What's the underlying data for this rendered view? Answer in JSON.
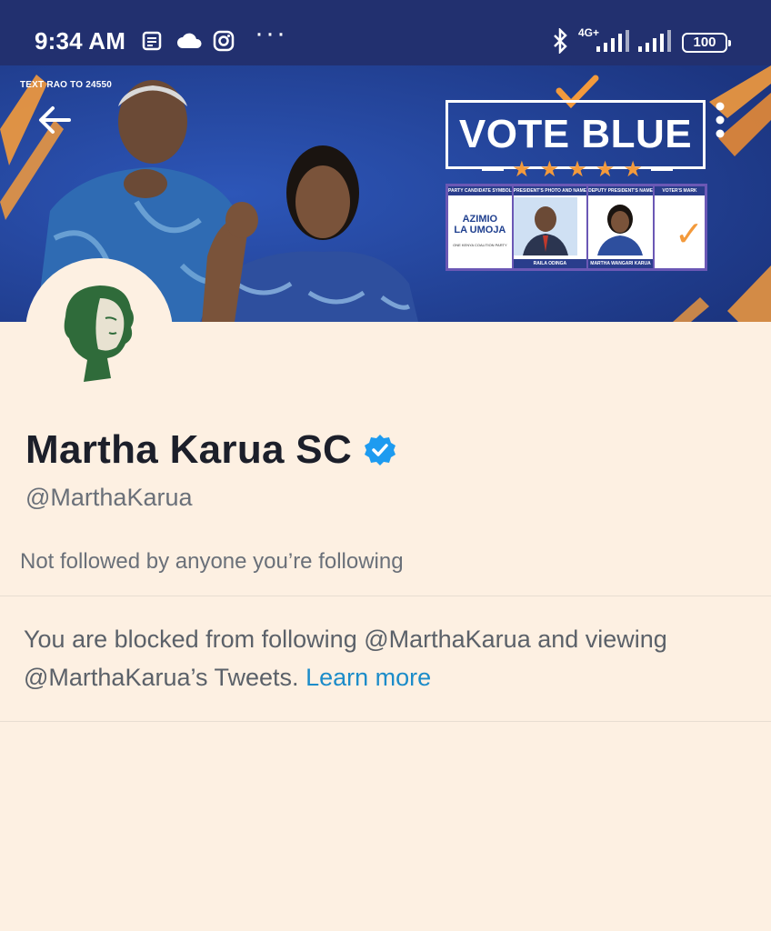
{
  "status_bar": {
    "time": "9:34 AM",
    "network_label": "4G+",
    "battery": "100"
  },
  "banner": {
    "top_text": "TEXT RAO TO 24550",
    "vote_headline": "VOTE BLUE",
    "ballot": {
      "headers": [
        "PARTY CANDIDATE SYMBOL",
        "PRESIDENT'S PHOTO AND NAME",
        "DEPUTY PRESIDENT'S NAME",
        "VOTER'S MARK"
      ],
      "party_line1": "AZIMIO",
      "party_line2": "LA UMOJA",
      "party_sub": "ONE KENYA COALITION PARTY",
      "president_name": "RAILA ODINGA",
      "deputy_name": "MARTHA WANGARI KARUA"
    }
  },
  "profile": {
    "name": "Martha Karua SC",
    "handle": "@MarthaKarua",
    "followers_context": "Not followed by anyone you’re following",
    "blocked_message": "You are blocked from following @MarthaKarua and viewing @MarthaKarua’s Tweets.",
    "learn_more": "Learn more"
  },
  "colors": {
    "status_bar_bg": "#22306f",
    "page_bg": "#fdf0e2",
    "accent_link": "#1c8cc9",
    "verified_badge": "#1d9bf0",
    "banner_orange": "#f39a3c"
  },
  "icons": [
    "notes-icon",
    "cloud-icon",
    "instagram-icon",
    "more-dots-icon",
    "bluetooth-icon",
    "signal-icon",
    "battery-icon",
    "back-arrow-icon",
    "overflow-menu-icon",
    "verified-badge-icon"
  ]
}
